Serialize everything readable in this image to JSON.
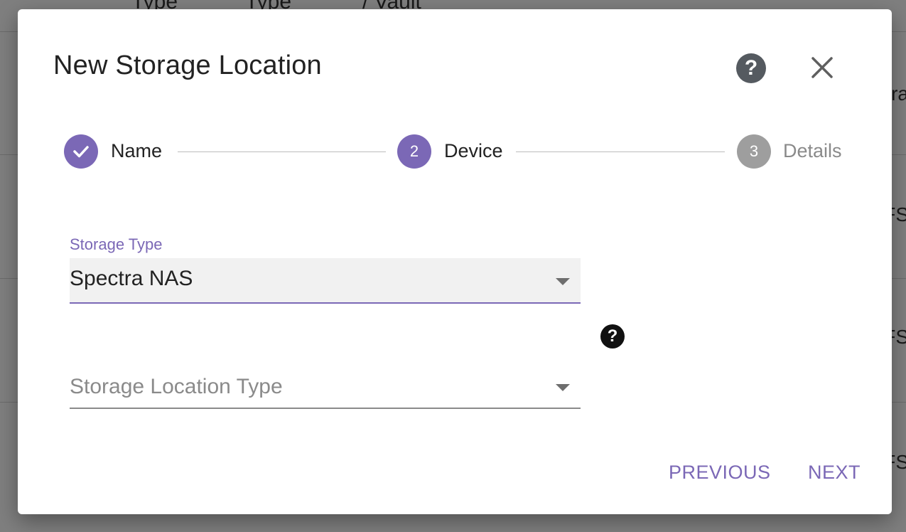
{
  "background": {
    "header_fragments": [
      "Type",
      "Type",
      "/ Vault"
    ],
    "row_edge_fragments": [
      "ra",
      "FS",
      "FS",
      "FS"
    ]
  },
  "dialog": {
    "title": "New Storage Location",
    "help_icon": "question-circle-icon",
    "close_icon": "close-icon"
  },
  "stepper": {
    "steps": [
      {
        "number": "1",
        "label": "Name",
        "state": "completed"
      },
      {
        "number": "2",
        "label": "Device",
        "state": "active"
      },
      {
        "number": "3",
        "label": "Details",
        "state": "inactive"
      }
    ]
  },
  "form": {
    "storage_type": {
      "label": "Storage Type",
      "value": "Spectra NAS"
    },
    "storage_location_type": {
      "placeholder": "Storage Location Type"
    },
    "help_glyph": "?"
  },
  "actions": {
    "previous": "PREVIOUS",
    "next": "NEXT"
  },
  "colors": {
    "accent": "#7b68b6",
    "inactive_step": "#9e9e9e",
    "help_button": "#555a60"
  }
}
